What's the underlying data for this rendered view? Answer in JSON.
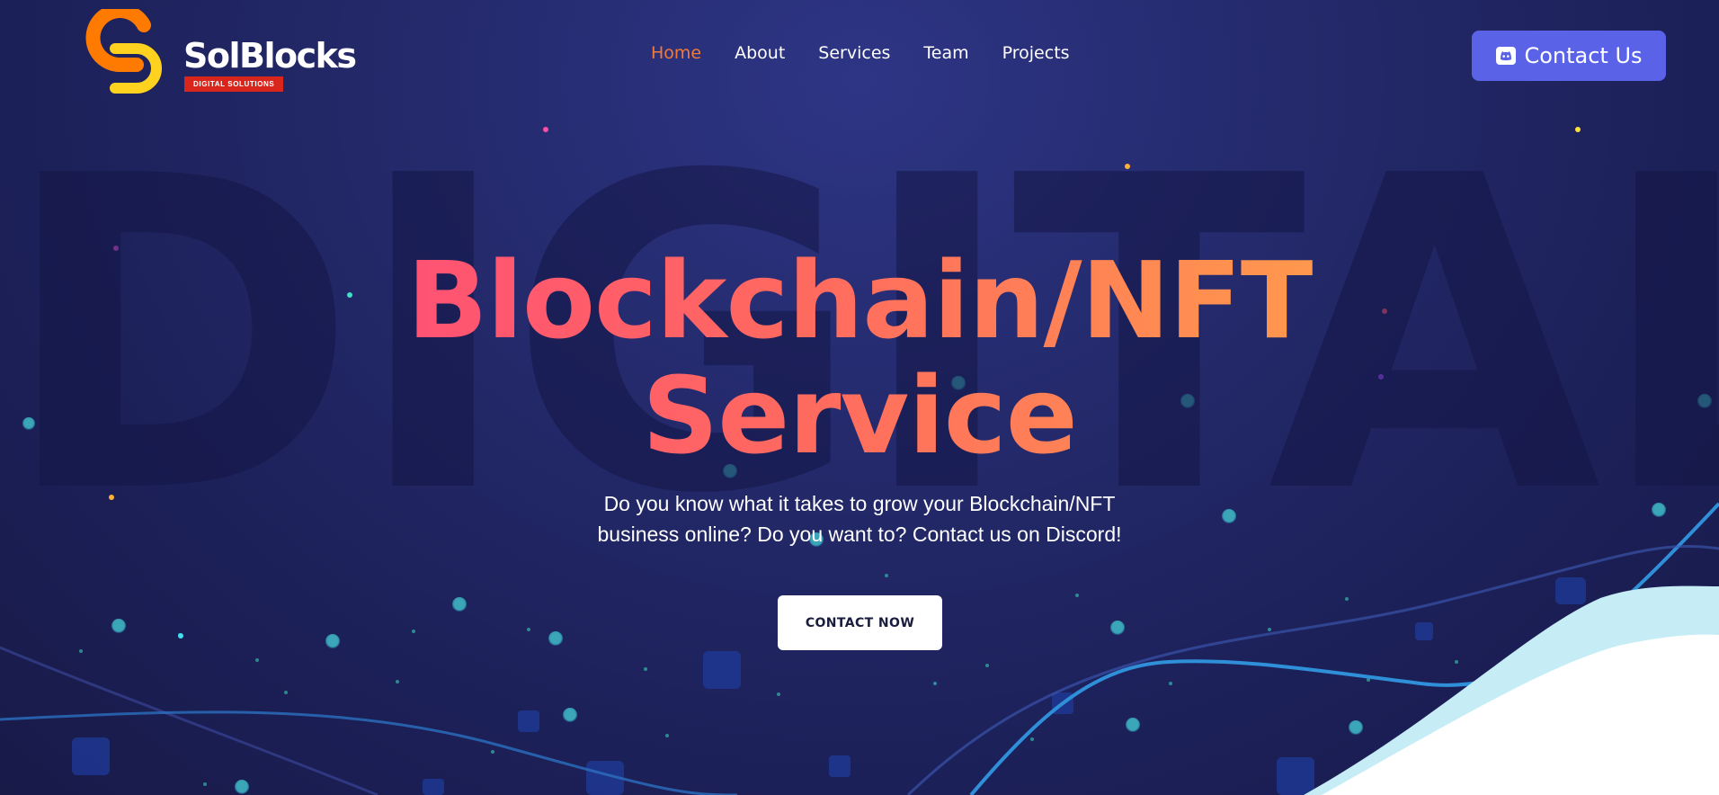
{
  "brand": {
    "name": "SolBlocks",
    "tagline": "DIGITAL SOLUTIONS",
    "watermark": "DIGITAL"
  },
  "nav": {
    "items": [
      {
        "label": "Home",
        "active": true
      },
      {
        "label": "About",
        "active": false
      },
      {
        "label": "Services",
        "active": false
      },
      {
        "label": "Team",
        "active": false
      },
      {
        "label": "Projects",
        "active": false
      }
    ]
  },
  "header": {
    "contact_label": "Contact Us",
    "contact_icon": "discord-icon"
  },
  "hero": {
    "title_line1": "Blockchain/NFT",
    "title_line2": "Service",
    "subtitle_line1": "Do you know what it takes to grow your Blockchain/NFT",
    "subtitle_line2": "business online? Do you want to? Contact us on Discord!",
    "cta_label": "CONTACT NOW"
  },
  "colors": {
    "accent_active": "#f27a3b",
    "button_primary": "#5a63e8",
    "headline_gradient": [
      "#ff4d78",
      "#ffa04a"
    ],
    "logo_orange": "#ff7a00",
    "logo_yellow": "#ffd21f",
    "tag_red": "#d9261c"
  }
}
